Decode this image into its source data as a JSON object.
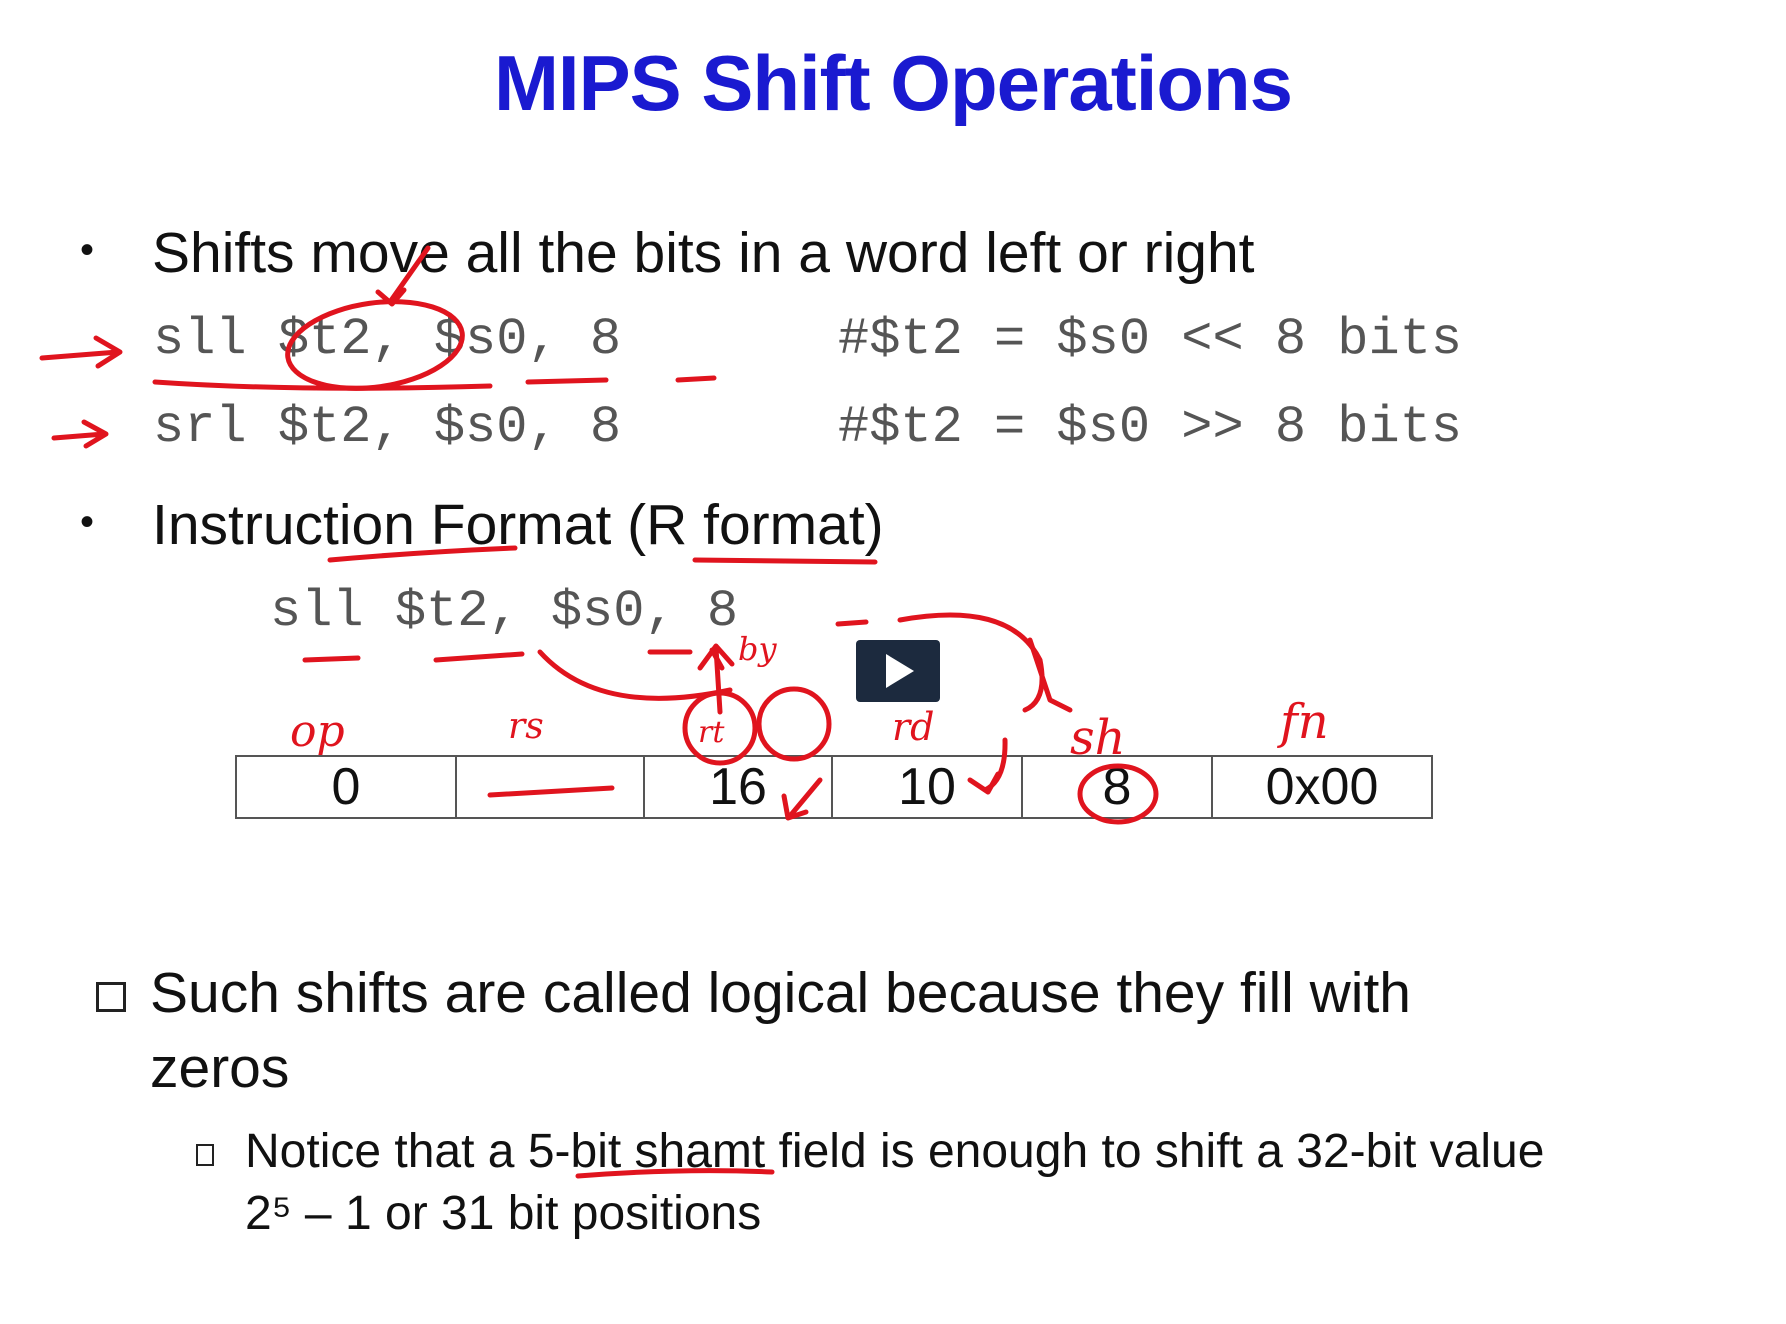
{
  "title": "MIPS Shift Operations",
  "bullets": [
    {
      "marker": "•",
      "text": "Shifts move all the bits in a word left or right"
    },
    {
      "marker": "•",
      "text": "Instruction Format (R format)"
    }
  ],
  "code_lines": [
    {
      "instr": "sll $t2, $s0, 8",
      "comment": "#$t2 = $s0 << 8 bits"
    },
    {
      "instr": "srl $t2, $s0, 8",
      "comment": "#$t2 = $s0 >> 8 bits"
    }
  ],
  "example_instr": "sll $t2, $s0, 8",
  "format_cells": [
    "0",
    "",
    "16",
    "10",
    "8",
    "0x00"
  ],
  "handwritten_labels": [
    "op",
    "rs",
    "rt",
    "rd",
    "sh",
    "fn",
    "by"
  ],
  "note_main_line1": "Such shifts are called logical because they fill with",
  "note_main_line2": "zeros",
  "note_sub_line1": "Notice that a 5-bit shamt field is enough to shift a 32-bit value",
  "note_sub_line2": "2⁵ – 1 or 31 bit positions",
  "colors": {
    "title": "#1a1ad0",
    "ink": "#e0141e",
    "play_bg": "#1c2a3e"
  },
  "icons": [
    "play-icon",
    "checkbox-bullet-icon"
  ]
}
